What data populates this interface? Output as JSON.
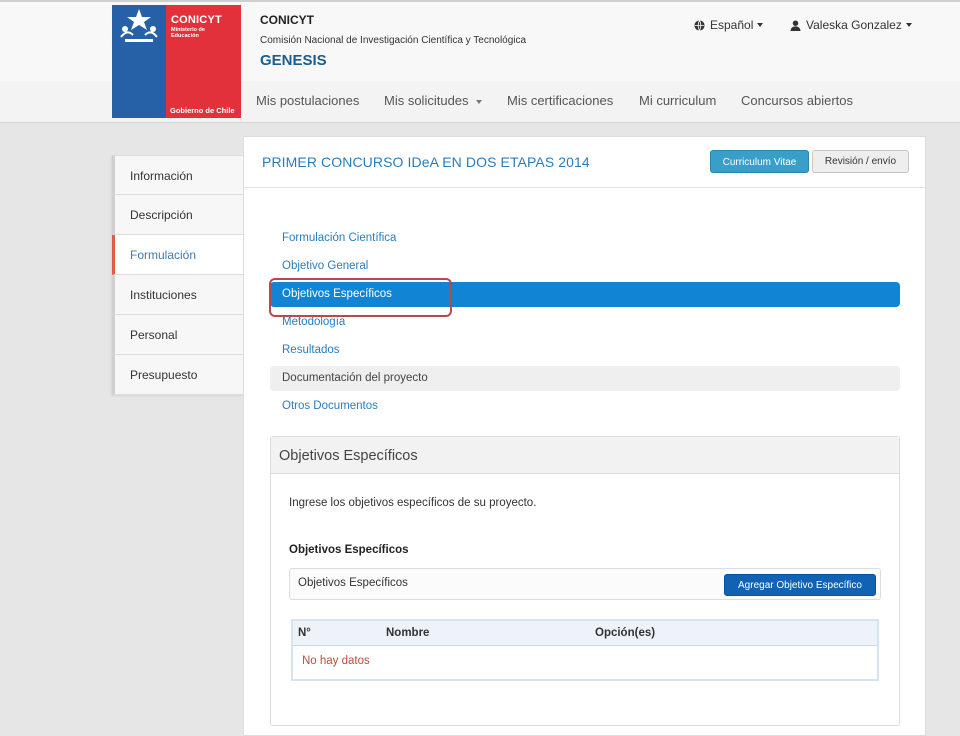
{
  "header": {
    "logo": {
      "brand": "CONICYT",
      "ministry": "Ministerio de Educación",
      "government": "Gobierno de Chile"
    },
    "org_short": "CONICYT",
    "org_full": "Comisión Nacional de Investigación Científica y Tecnológica",
    "app_name": "GENESIS",
    "language_label": "Español",
    "language_icon": "globe-icon",
    "user_name": "Valeska Gonzalez",
    "user_icon": "user-icon"
  },
  "nav": {
    "items": [
      {
        "label": "Mis postulaciones"
      },
      {
        "label": "Mis solicitudes",
        "has_dropdown": true
      },
      {
        "label": "Mis certificaciones"
      },
      {
        "label": "Mi curriculum"
      },
      {
        "label": "Concursos abiertos"
      }
    ]
  },
  "sidebar": {
    "items": [
      {
        "label": "Información"
      },
      {
        "label": "Descripción"
      },
      {
        "label": "Formulación",
        "active": true
      },
      {
        "label": "Instituciones"
      },
      {
        "label": "Personal"
      },
      {
        "label": "Presupuesto"
      }
    ]
  },
  "panel": {
    "title": "PRIMER CONCURSO IDeA EN DOS ETAPAS 2014",
    "btn_cv": "Curriculum Vitae",
    "btn_review": "Revisión / envío",
    "subnav": [
      {
        "label": "Formulación Científica"
      },
      {
        "label": "Objetivo General"
      },
      {
        "label": "Objetivos Específicos",
        "active": true
      },
      {
        "label": "Metodología"
      },
      {
        "label": "Resultados"
      },
      {
        "label": "Documentación del proyecto",
        "muted": true
      },
      {
        "label": "Otros Documentos"
      }
    ],
    "section": {
      "title": "Objetivos Específicos",
      "description": "Ingrese los objetivos específicos de su proyecto.",
      "list_label": "Objetivos Específicos",
      "list_box_label": "Objetivos Específicos",
      "add_button": "Agregar Objetivo Específico",
      "table_headers": [
        "N°",
        "Nombre",
        "Opción(es)"
      ],
      "empty_message": "No hay datos"
    }
  },
  "colors": {
    "primary_blue": "#1185d4",
    "link_blue": "#2a7dbb",
    "button_dark_blue": "#1262b4",
    "logo_blue": "#2660a6",
    "logo_red": "#e2313b",
    "active_tab_accent": "#e25a48",
    "highlight_outline": "#b64a4a",
    "empty_text": "#b84c3c"
  }
}
